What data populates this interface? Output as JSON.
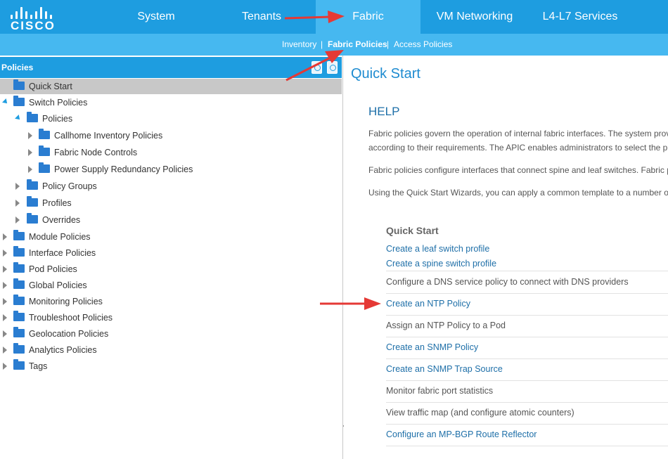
{
  "nav": {
    "tabs": [
      "System",
      "Tenants",
      "Fabric",
      "VM Networking",
      "L4-L7 Services"
    ],
    "active": "Fabric",
    "logo_text": "CISCO"
  },
  "subnav": {
    "items": [
      "Inventory",
      "Fabric Policies",
      "Access Policies"
    ],
    "active": "Fabric Policies",
    "separator": "|"
  },
  "left_panel": {
    "title": "Policies",
    "tree": [
      {
        "label": "Quick Start",
        "selected": true
      },
      {
        "label": "Switch Policies",
        "expanded": true
      },
      {
        "label": "Policies",
        "expanded": true
      },
      {
        "label": "Callhome Inventory Policies"
      },
      {
        "label": "Fabric Node Controls"
      },
      {
        "label": "Power Supply Redundancy Policies"
      },
      {
        "label": "Policy Groups"
      },
      {
        "label": "Profiles"
      },
      {
        "label": "Overrides"
      },
      {
        "label": "Module Policies"
      },
      {
        "label": "Interface Policies"
      },
      {
        "label": "Pod Policies"
      },
      {
        "label": "Global Policies"
      },
      {
        "label": "Monitoring Policies"
      },
      {
        "label": "Troubleshoot Policies"
      },
      {
        "label": "Geolocation Policies"
      },
      {
        "label": "Analytics Policies"
      },
      {
        "label": "Tags"
      }
    ]
  },
  "main": {
    "title": "Quick Start",
    "help_title": "HELP",
    "paragraphs": [
      "Fabric policies govern the operation of internal fabric interfaces. The system prov",
      "according to their requirements. The APIC enables administrators to select the p",
      "Fabric policies configure interfaces that connect spine and leaf switches. Fabric p",
      "Using the Quick Start Wizards, you can apply a common template to a number of"
    ],
    "quick_start_heading": "Quick Start",
    "quick_start_items": [
      {
        "label": "Create a leaf switch profile",
        "link": true
      },
      {
        "label": "Create a spine switch profile",
        "link": true
      },
      {
        "label": "Configure a DNS service policy to connect with DNS providers",
        "link": false
      },
      {
        "label": "Create an NTP Policy",
        "link": true
      },
      {
        "label": "Assign an NTP Policy to a Pod",
        "link": false
      },
      {
        "label": "Create an SNMP Policy",
        "link": true
      },
      {
        "label": "Create an SNMP Trap Source",
        "link": true
      },
      {
        "label": "Monitor fabric port statistics",
        "link": false
      },
      {
        "label": "View traffic map (and configure atomic counters)",
        "link": false
      },
      {
        "label": "Configure an MP-BGP Route Reflector",
        "link": true
      }
    ]
  },
  "colors": {
    "nav_blue": "#1e9de0",
    "nav_active": "#46b8f0",
    "link": "#1e6fa8",
    "annotation_red": "#e53935"
  }
}
